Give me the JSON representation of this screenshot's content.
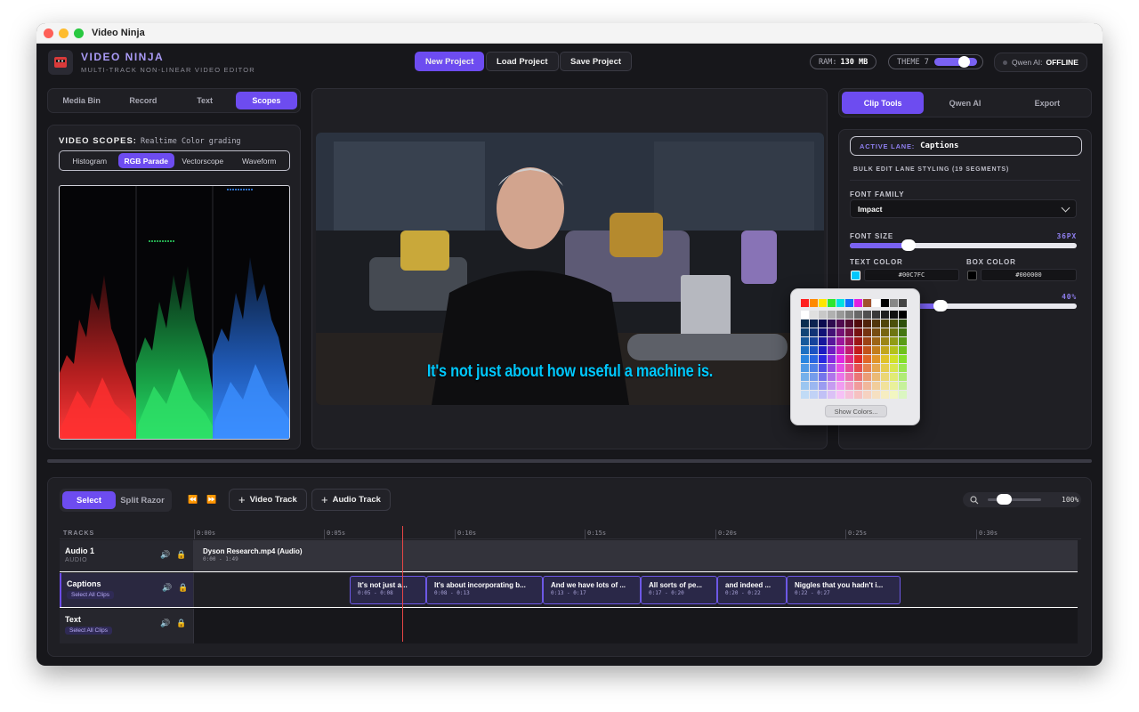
{
  "window": {
    "title": "Video Ninja"
  },
  "brand": {
    "title": "VIDEO NINJA",
    "subtitle": "MULTI-TRACK NON-LINEAR VIDEO EDITOR"
  },
  "toolbar": {
    "new_project": "New Project",
    "load_project": "Load Project",
    "save_project": "Save Project"
  },
  "status": {
    "ram_label": "RAM:",
    "ram_value": "130 MB",
    "theme_label": "THEME 7",
    "ai_label": "Qwen AI:",
    "ai_value": "OFFLINE"
  },
  "left_tabs": [
    "Media Bin",
    "Record",
    "Text",
    "Scopes"
  ],
  "scopes": {
    "title": "VIDEO SCOPES:",
    "subtitle": "Realtime Color grading",
    "tabs": [
      "Histogram",
      "RGB Parade",
      "Vectorscope",
      "Waveform"
    ]
  },
  "preview": {
    "subtitle_text": "It's not just about how useful a machine is."
  },
  "right_tabs": [
    "Clip Tools",
    "Qwen AI",
    "Export"
  ],
  "clip_tools": {
    "active_lane_label": "ACTIVE LANE:",
    "active_lane_value": "Captions",
    "bulk_edit": "BULK EDIT LANE STYLING (19 SEGMENTS)",
    "font_family_label": "FONT FAMILY",
    "font_family_value": "Impact",
    "font_size_label": "FONT SIZE",
    "font_size_value": "36PX",
    "font_size_fraction": 0.26,
    "text_color_label": "TEXT COLOR",
    "text_color_value": "#00C7FC",
    "box_color_label": "BOX COLOR",
    "box_color_value": "#000000",
    "opacity_value": "40%",
    "opacity_fraction": 0.4
  },
  "color_picker": {
    "show_colors": "Show Colors..."
  },
  "timeline": {
    "tools": [
      "Select",
      "Split Razor"
    ],
    "add_video": "Video Track",
    "add_audio": "Audio Track",
    "zoom": "100%",
    "tracks_label": "TRACKS",
    "ticks": [
      "0:00s",
      "0:05s",
      "0:10s",
      "0:15s",
      "0:20s",
      "0:25s",
      "0:30s"
    ],
    "select_all": "Select All Clips",
    "tracks": [
      {
        "name": "Audio 1",
        "type": "AUDIO",
        "clips": [
          {
            "title": "Dyson Research.mp4 (Audio)",
            "time": "0:00 - 1:49"
          }
        ]
      },
      {
        "name": "Captions",
        "type": "",
        "clips": [
          {
            "title": "It's not just a...",
            "time": "0:05 - 0:08"
          },
          {
            "title": "It's about incorporating b...",
            "time": "0:08 - 0:13"
          },
          {
            "title": "And we have lots of ...",
            "time": "0:13 - 0:17"
          },
          {
            "title": "All sorts of pe...",
            "time": "0:17 - 0:20"
          },
          {
            "title": "and indeed ...",
            "time": "0:20 - 0:22"
          },
          {
            "title": "Niggles that you hadn't i...",
            "time": "0:22 - 0:27"
          }
        ]
      },
      {
        "name": "Text",
        "type": "",
        "clips": []
      }
    ]
  }
}
